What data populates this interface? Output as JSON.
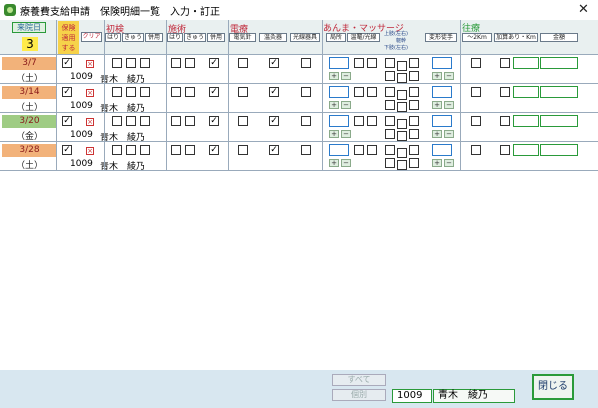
{
  "window": {
    "title": "療養費支給申請　保険明細一覧　入力・訂正",
    "close_glyph": "✕"
  },
  "header": {
    "visit_day_label": "来院日",
    "visit_day_count": "3",
    "insurance_apply_label": "保険適用する",
    "clear_label": "クリア",
    "shoken_label": "初検",
    "sejutsu_label": "施術",
    "denryo_label": "電療",
    "anma_label": "あんま・マッサージ",
    "oushin_label": "往療",
    "cols": {
      "hari": "はり",
      "kyu": "きゅう",
      "heiyou": "併用",
      "denki": "電気針",
      "onkyu": "温灸器",
      "kousen": "光線器具",
      "kyokusho": "局所",
      "onshippu": "温罨/光線",
      "joshi": "上肢(左右)",
      "taikan": "躯幹",
      "kashi": "下肢(左右)",
      "henkei": "変形徒手",
      "dist2": "～2Km",
      "kasan": "加算あり・Km",
      "kingaku": "金額"
    }
  },
  "rows": [
    {
      "date": "3/7",
      "dow": "（土）",
      "color": "#f2b27a",
      "patient_id": "1009",
      "patient_name": "青木　綾乃"
    },
    {
      "date": "3/14",
      "dow": "（土）",
      "color": "#f2b27a",
      "patient_id": "1009",
      "patient_name": "青木　綾乃"
    },
    {
      "date": "3/20",
      "dow": "（金）",
      "color": "#9fcc84",
      "patient_id": "1009",
      "patient_name": "青木　綾乃"
    },
    {
      "date": "3/28",
      "dow": "（土）",
      "color": "#f2b27a",
      "patient_id": "1009",
      "patient_name": "青木　綾乃"
    }
  ],
  "glyphs": {
    "check": "✓",
    "x": "×",
    "plus": "+",
    "minus": "−"
  },
  "footer": {
    "all_label": "すべて",
    "each_label": "個別",
    "patient_id": "1009",
    "patient_name": "青木　綾乃",
    "close_label": "閉じる"
  }
}
